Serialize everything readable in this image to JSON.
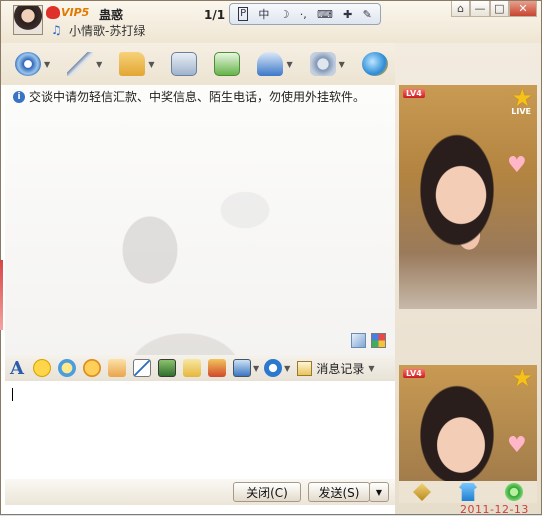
{
  "window": {
    "nickname": "蛊惑",
    "vip_label": "VIP5",
    "song": "小情歌-苏打绿",
    "page_indicator": "1/1",
    "buttons": {
      "skin": "⌂",
      "minimize": "—",
      "maximize": "□",
      "close": "✕"
    }
  },
  "ime_bar": {
    "items": [
      "P",
      "中",
      "☽",
      "·,",
      "⌨",
      "✚",
      "✎"
    ]
  },
  "toolbar": {
    "items": [
      {
        "name": "video-chat",
        "icon": "webcam-icon",
        "dropdown": true
      },
      {
        "name": "voice-chat",
        "icon": "microphone-icon",
        "dropdown": true
      },
      {
        "name": "send-file",
        "icon": "folder-icon",
        "dropdown": true
      },
      {
        "name": "send-email",
        "icon": "mail-icon",
        "dropdown": false
      },
      {
        "name": "create-group",
        "icon": "add-group-icon",
        "dropdown": false
      },
      {
        "name": "remote-assist",
        "icon": "video-icon",
        "dropdown": true
      },
      {
        "name": "app-settings",
        "icon": "gear-icon",
        "dropdown": true
      },
      {
        "name": "app-center",
        "icon": "globe-icon",
        "dropdown": false
      }
    ]
  },
  "chat": {
    "notice": "交谈中请勿轻信汇款、中奖信息、陌生电话，勿使用外挂软件。"
  },
  "format_bar": {
    "font_glyph": "A",
    "message_log_label": "消息记录"
  },
  "actions": {
    "close_label": "关闭(C)",
    "send_label": "发送(S)"
  },
  "profile": {
    "level_badge": "LV4",
    "live_label": "LIVE",
    "level_badge_2": "LV4"
  },
  "taskbar": {
    "date": "2011-12-13"
  },
  "colors": {
    "title_bg": "#efe5d2",
    "accent_blue": "#2a64c8",
    "vip_orange": "#e07a00",
    "date_red": "#c8413c"
  }
}
